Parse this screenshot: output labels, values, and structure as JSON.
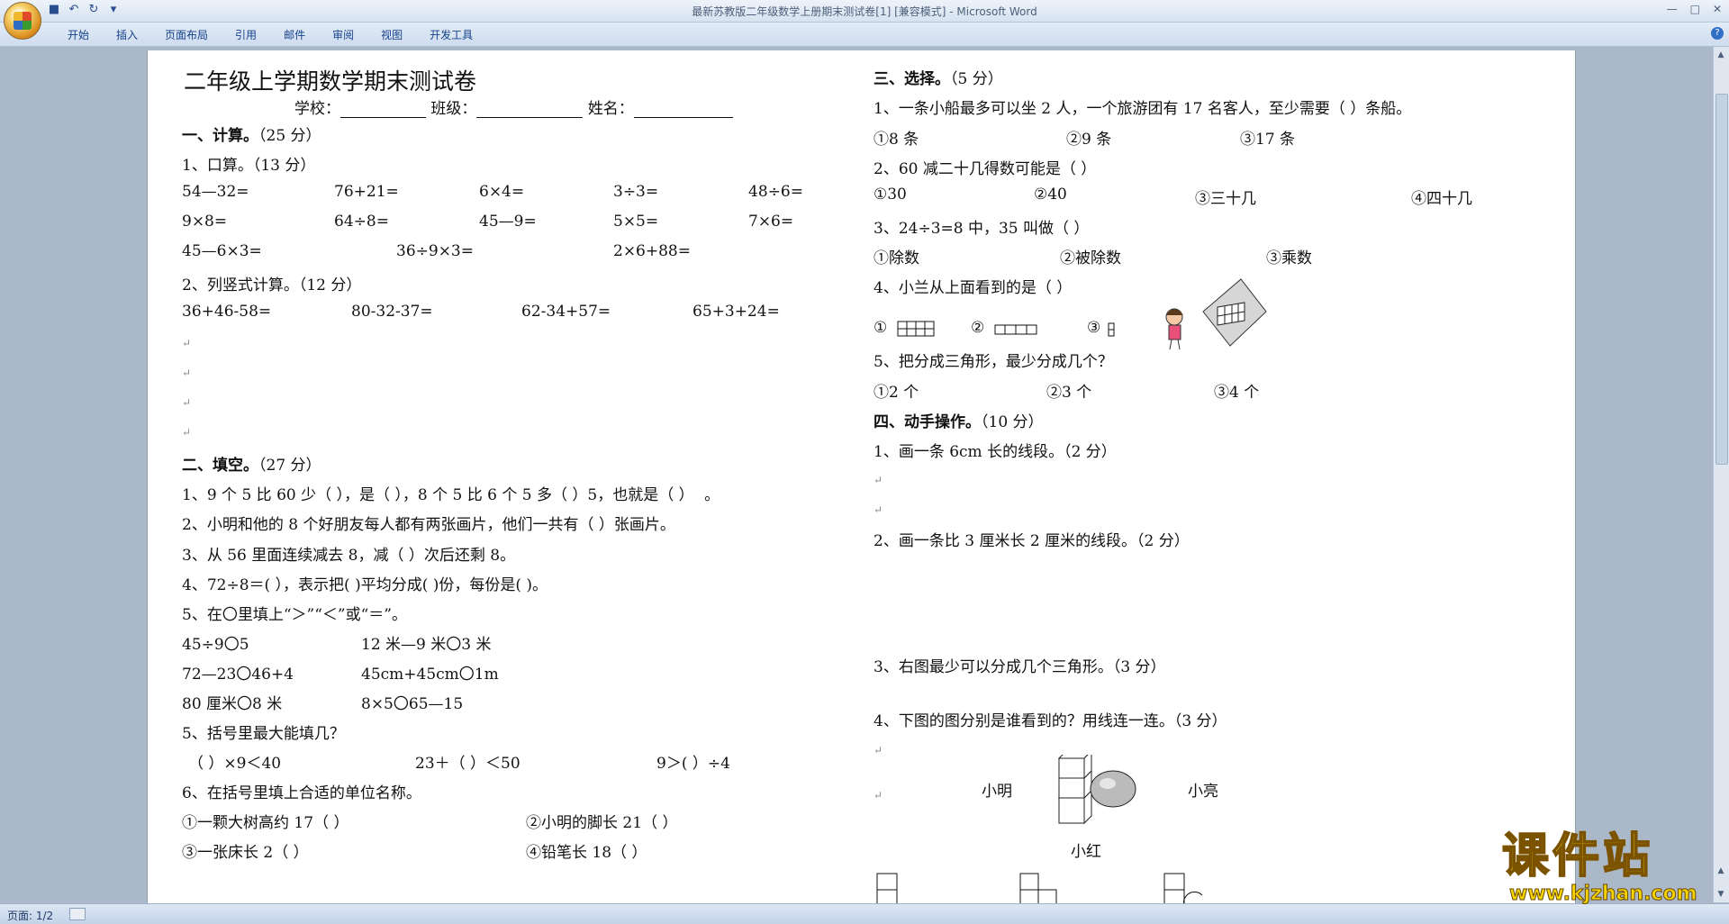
{
  "window": {
    "title": "最新苏教版二年级数学上册期末测试卷[1] [兼容模式] - Microsoft Word",
    "min_icon": "minimize-icon",
    "max_icon": "maximize-icon",
    "close_icon": "close-icon"
  },
  "ribbon": {
    "tabs": [
      "开始",
      "插入",
      "页面布局",
      "引用",
      "邮件",
      "审阅",
      "视图",
      "开发工具"
    ]
  },
  "status": {
    "page": "页面: 1/2"
  },
  "watermark": {
    "brand": "课件站",
    "url": "www.kjzhan.com"
  },
  "doc": {
    "title": "二年级上学期数学期末测试卷",
    "info": {
      "school": "学校：",
      "class": "班级：",
      "name": "姓名："
    },
    "s1": {
      "heading": "一、计算。",
      "score": "（25 分）",
      "q1": "1、口算。（13 分）",
      "row1": [
        "54—32=",
        "76+21=",
        "6×4=",
        "3÷3=",
        "48÷6="
      ],
      "row2": [
        "9×8=",
        "64÷8=",
        "45—9=",
        "5×5=",
        "7×6="
      ],
      "row3": [
        "45—6×3=",
        "36÷9×3=",
        "2×6+88="
      ],
      "q2": "2、列竖式计算。（12 分）",
      "row4": [
        "36+46-58=",
        "80-32-37=",
        "62-34+57=",
        "65+3+24="
      ]
    },
    "s2": {
      "heading": "二、填空。",
      "score": "（27 分）",
      "l1": "1、9 个 5 比 60 少（    ），是（   ），8 个 5 比 6 个 5 多（    ）5，也就是（    ）",
      "l1end": "。",
      "l2": "2、小明和他的 8 个好朋友每人都有两张画片，他们一共有（    ）张画片。",
      "l3": "3、从 56 里面连续减去 8，减（   ）次后还剩 8。",
      "l4": "4、72÷8＝(    ），表示把(   )平均分成(   )份，每份是(   )。",
      "l5": "5、在〇里填上“＞”“＜”或“＝”。",
      "c1": [
        "45÷9〇5",
        "12 米—9 米〇3 米"
      ],
      "c2": [
        "72—23〇46+4",
        "45cm+45cm〇1m"
      ],
      "c3": [
        "80 厘米〇8 米",
        "8×5〇65—15"
      ],
      "l6": "5、括号里最大能填几？",
      "m1": [
        "（     ）×9＜40",
        "23＋（     ）＜50",
        "9＞(          ）÷4"
      ],
      "l7": "6、在括号里填上合适的单位名称。",
      "u1": [
        "①一颗大树高约 17（       ）",
        "②小明的脚长 21（       ）"
      ],
      "u2": [
        "③一张床长 2（       ）",
        "④铅笔长 18（       ）"
      ]
    },
    "s3": {
      "heading": "三、选择。",
      "score": "（5 分）",
      "q1": "1、一条小船最多可以坐 2 人，一个旅游团有 17 名客人，至少需要（          ）条船。",
      "a1": [
        "①8 条",
        "②9 条",
        "③17 条"
      ],
      "q2": "2、60 减二十几得数可能是（          ）",
      "a2": [
        "①30",
        "②40",
        "③三十几",
        "④四十几"
      ],
      "q3": "3、24÷3=8 中，35 叫做（          ）",
      "a3": [
        "①除数",
        "②被除数",
        "③乘数"
      ],
      "q4": "4、小兰从上面看到的是（          ）",
      "a4": [
        "①",
        "②",
        "③"
      ],
      "q5": "5、把分成三角形，最少分成几个？",
      "a5": [
        "①2 个",
        "②3 个",
        "③4 个"
      ]
    },
    "s4": {
      "heading": "四、动手操作。",
      "score": "（10 分）",
      "q1": "1、画一条 6cm 长的线段。（2 分）",
      "q2": "2、画一条比 3 厘米长 2 厘米的线段。（2 分）",
      "q3": "3、右图最少可以分成几个三角形。（3 分）",
      "q4": "4、下图的图分别是谁看到的？用线连一连。（3 分）",
      "names": [
        "小明",
        "小亮",
        "小红"
      ]
    }
  }
}
